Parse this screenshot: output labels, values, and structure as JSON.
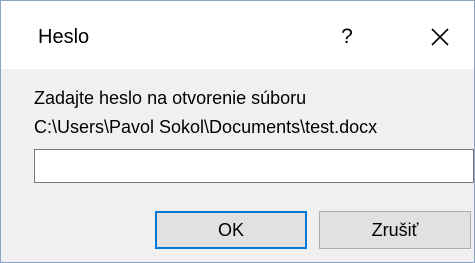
{
  "dialog": {
    "title": "Heslo",
    "help_label": "?",
    "close_icon": "close-icon"
  },
  "main": {
    "prompt": "Zadajte heslo na otvorenie súboru",
    "file_path": "C:\\Users\\Pavol Sokol\\Documents\\test.docx",
    "password_value": "",
    "password_placeholder": ""
  },
  "buttons": {
    "ok_label": "OK",
    "cancel_label": "Zrušiť"
  },
  "colors": {
    "accent": "#0078d7",
    "dialog_bg": "#f0f0f0",
    "button_bg": "#e1e1e1"
  }
}
